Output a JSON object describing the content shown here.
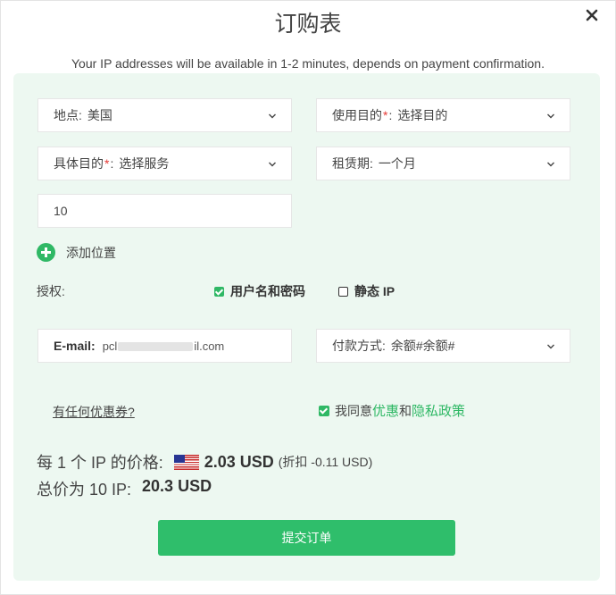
{
  "header": {
    "title": "订购表",
    "close_icon": "close-icon",
    "subtitle": "Your IP addresses will be available in 1-2 minutes, depends on payment confirmation."
  },
  "form": {
    "location": {
      "label": "地点:",
      "value": "美国"
    },
    "usage_purpose": {
      "label": "使用目的",
      "required": "*",
      "colon": ":",
      "value": "选择目的"
    },
    "specific_purpose": {
      "label": "具体目的",
      "required": "*",
      "colon": ":",
      "value": "选择服务"
    },
    "lease_period": {
      "label": "租赁期:",
      "value": "一个月"
    },
    "quantity": {
      "value": "10"
    },
    "add_location": {
      "label": "添加位置",
      "icon": "plus-circle-icon"
    },
    "authorization": {
      "label": "授权:",
      "options": [
        {
          "label": "用户名和密码",
          "checked": true
        },
        {
          "label": "静态 IP",
          "checked": false
        }
      ]
    },
    "email": {
      "label": "E-mail:",
      "value_start": "pcl",
      "value_end": "il.com"
    },
    "payment_method": {
      "label": "付款方式:",
      "value": "余额#余额#"
    },
    "coupon_link": "有任何优惠券?",
    "agreement": {
      "checked": true,
      "prefix": "我同意",
      "link1": "优惠",
      "middle": "和",
      "link2": "隐私政策"
    }
  },
  "pricing": {
    "per_ip_label": "每 1 个 IP 的价格:",
    "flag_icon": "us-flag-icon",
    "per_ip_price": "2.03 USD",
    "discount": "(折扣 -0.11 USD)",
    "total_label": "总价为 10 IP:",
    "total_price": "20.3 USD"
  },
  "submit_label": "提交订单",
  "colors": {
    "accent": "#2fb865",
    "panel_bg": "#edf8f1",
    "required": "#e53935"
  }
}
